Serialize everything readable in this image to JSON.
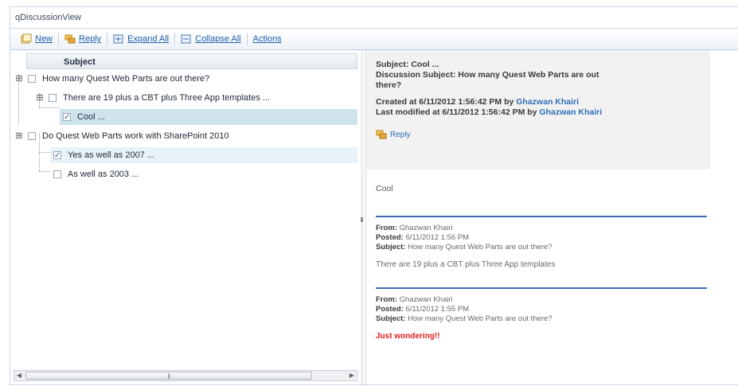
{
  "window": {
    "title": "qDiscussionView"
  },
  "toolbar": {
    "new_label": "New",
    "reply_label": "Reply",
    "expand_label": "Expand All",
    "collapse_label": "Collapse All",
    "actions_label": "Actions"
  },
  "tree": {
    "column_header": "Subject",
    "nodes": [
      {
        "label": "How many Quest Web Parts are out there?",
        "expander": "⊞",
        "checked": false
      },
      {
        "label": "There are 19 plus a CBT plus Three App templates ...",
        "expander": "⊞",
        "checked": false
      },
      {
        "label": "Cool ...",
        "checked": true,
        "selected": true
      },
      {
        "label": "Do Quest Web Parts work with SharePoint 2010",
        "expander": "⊞",
        "checked": false
      },
      {
        "label": "Yes as well as 2007 ...",
        "checked": true
      },
      {
        "label": "As well as 2003 ...",
        "checked": false
      }
    ]
  },
  "detail": {
    "subject_line": "Subject: Cool ...",
    "discussion_subject_1": "Discussion Subject: How many Quest Web Parts are out",
    "discussion_subject_2": "there?",
    "created_prefix": "Created at 6/11/2012 1:56:42 PM by ",
    "created_author": "Ghazwan Khairi",
    "modified_prefix": "Last modified at 6/11/2012 1:56:42 PM by ",
    "modified_author": "Ghazwan Khairi",
    "reply_label": "Reply",
    "body": "Cool"
  },
  "messages": [
    {
      "from_label": "From:",
      "from": "Ghazwan Khairi",
      "posted_label": "Posted:",
      "posted": "6/11/2012 1:56 PM",
      "subject_label": "Subject:",
      "subject": "How many Quest Web Parts are out there?",
      "text": "There are 19 plus a CBT plus Three App templates"
    },
    {
      "from_label": "From:",
      "from": "Ghazwan Khairi",
      "posted_label": "Posted:",
      "posted": "6/11/2012 1:55 PM",
      "subject_label": "Subject:",
      "subject": "How many Quest Web Parts are out there?",
      "text": "Just wondering!!"
    }
  ],
  "colors": {
    "accent": "#2e6fb7",
    "selection": "#cfe3ec",
    "rule": "#3d6cb4",
    "alert": "#e21d1d"
  }
}
